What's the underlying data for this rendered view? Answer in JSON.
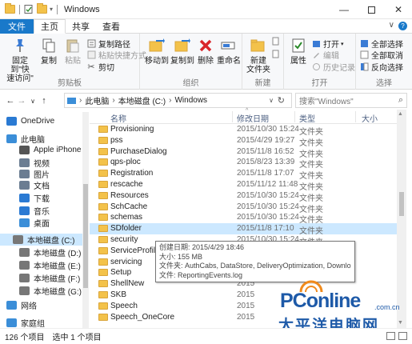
{
  "window": {
    "title": "Windows"
  },
  "tabs": [
    "文件",
    "主页",
    "共享",
    "查看"
  ],
  "ribbon": {
    "clipboard": {
      "pin_label_1": "固定到\"快",
      "pin_label_2": "速访问\"",
      "copy": "复制",
      "paste": "粘贴",
      "cut": "剪切",
      "copy_path": "复制路径",
      "paste_shortcut": "粘贴快捷方式",
      "group_label": "剪贴板"
    },
    "organize": {
      "move_to": "移动到",
      "copy_to": "复制到",
      "delete": "删除",
      "rename": "重命名",
      "group_label": "组织"
    },
    "new": {
      "new_folder_1": "新建",
      "new_folder_2": "文件夹",
      "group_label": "新建"
    },
    "open": {
      "properties": "属性",
      "open": "打开",
      "edit": "编辑",
      "history": "历史记录",
      "group_label": "打开"
    },
    "select": {
      "select_all": "全部选择",
      "select_none": "全部取消",
      "invert": "反向选择",
      "group_label": "选择"
    }
  },
  "address": {
    "crumb_1": "此电脑",
    "crumb_2": "本地磁盘 (C:)",
    "crumb_3": "Windows",
    "search_placeholder": "搜索\"Windows\""
  },
  "nav": [
    {
      "label": "OneDrive",
      "color": "#2a7ad3"
    },
    {
      "label": "此电脑",
      "color": "#3b8ed8"
    },
    {
      "label": "Apple iPhone",
      "color": "#555555"
    },
    {
      "label": "视频",
      "color": "#6b7d92"
    },
    {
      "label": "图片",
      "color": "#6b7d92"
    },
    {
      "label": "文档",
      "color": "#6b7d92"
    },
    {
      "label": "下载",
      "color": "#2a7ad3"
    },
    {
      "label": "音乐",
      "color": "#2a7ad3"
    },
    {
      "label": "桌面",
      "color": "#3b8ed8"
    },
    {
      "label": "本地磁盘 (C:)",
      "color": "#777777"
    },
    {
      "label": "本地磁盘 (D:)",
      "color": "#777777"
    },
    {
      "label": "本地磁盘 (E:)",
      "color": "#777777"
    },
    {
      "label": "本地磁盘 (F:)",
      "color": "#777777"
    },
    {
      "label": "本地磁盘 (G:)",
      "color": "#777777"
    },
    {
      "label": "网络",
      "color": "#3b8ed8"
    },
    {
      "label": "家庭组",
      "color": "#3b8ed8"
    }
  ],
  "columns": {
    "name": "名称",
    "date": "修改日期",
    "type": "类型",
    "size": "大小"
  },
  "rows": [
    {
      "name": "Provisioning",
      "date": "2015/10/30 15:24",
      "type": "文件夹"
    },
    {
      "name": "pss",
      "date": "2015/4/29 19:27",
      "type": "文件夹"
    },
    {
      "name": "PurchaseDialog",
      "date": "2015/11/8 16:52",
      "type": "文件夹"
    },
    {
      "name": "qps-ploc",
      "date": "2015/8/23 13:39",
      "type": "文件夹"
    },
    {
      "name": "Registration",
      "date": "2015/11/8 17:07",
      "type": "文件夹"
    },
    {
      "name": "rescache",
      "date": "2015/11/12 11:48",
      "type": "文件夹"
    },
    {
      "name": "Resources",
      "date": "2015/10/30 15:24",
      "type": "文件夹"
    },
    {
      "name": "SchCache",
      "date": "2015/10/30 15:24",
      "type": "文件夹"
    },
    {
      "name": "schemas",
      "date": "2015/10/30 15:24",
      "type": "文件夹"
    },
    {
      "name": "SDfolder",
      "date": "2015/11/8 17:10",
      "type": "文件夹"
    },
    {
      "name": "security",
      "date": "2015/10/30 15:24",
      "type": "文件夹"
    },
    {
      "name": "ServiceProfiles",
      "date": "",
      "type": ""
    },
    {
      "name": "servicing",
      "date": "",
      "type": ""
    },
    {
      "name": "Setup",
      "date": "",
      "type": ""
    },
    {
      "name": "ShellNew",
      "date": "2015",
      "type": ""
    },
    {
      "name": "SKB",
      "date": "2015",
      "type": ""
    },
    {
      "name": "Speech",
      "date": "2015",
      "type": ""
    },
    {
      "name": "Speech_OneCore",
      "date": "2015",
      "type": ""
    }
  ],
  "tooltip": {
    "line1": "创建日期: 2015/4/29 18:46",
    "line2": "大小: 155 MB",
    "line3": "文件夹: AuthCabs, DataStore, DeliveryOptimization, Download, ...",
    "line4": "文件: ReportingEvents.log"
  },
  "status": {
    "count": "126 个项目",
    "selected": "选中 1 个项目"
  },
  "watermark": {
    "brand": "PConline",
    "domain": ".com.cn",
    "cn": "太平洋电脑网"
  }
}
